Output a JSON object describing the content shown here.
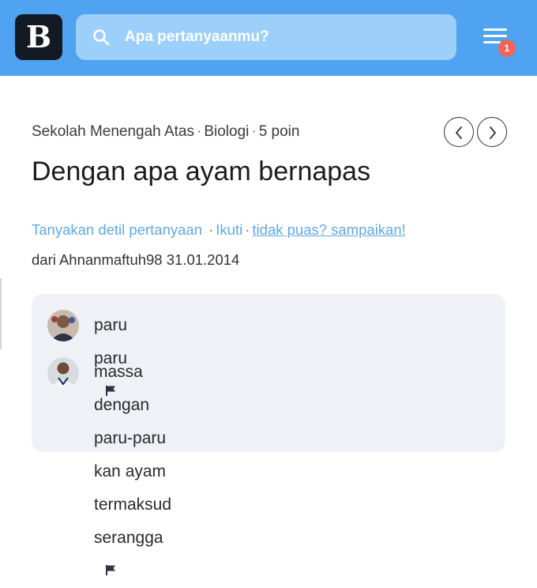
{
  "header": {
    "logo_letter": "B",
    "search": {
      "placeholder": "Apa pertanyaanmu?"
    },
    "notification_count": "1",
    "colors": {
      "header_bg": "#4fa3f0",
      "search_bg": "#9ccff9",
      "logo_bg": "#141a24",
      "badge": "#f1645a"
    }
  },
  "question": {
    "level": "Sekolah Menengah Atas",
    "subject": "Biologi",
    "points": "5 poin",
    "title": "Dengan apa ayam bernapas",
    "actions": {
      "ask_detail": "Tanyakan detil pertanyaan",
      "follow": "Ikuti",
      "report": "tidak puas? sampaikan!"
    },
    "asked_by": "dari Ahnanmaftuh98 31.01.2014"
  },
  "comments": [
    {
      "text": "paru paru",
      "avatar": "avatar-user-1"
    },
    {
      "text_line1": "massa dengan paru-paru kan ayam",
      "text_line2": "termaksud serangga",
      "avatar": "avatar-user-2"
    }
  ],
  "icons": [
    "search-icon",
    "menu-icon",
    "chevron-left-icon",
    "chevron-right-icon",
    "flag-icon"
  ]
}
